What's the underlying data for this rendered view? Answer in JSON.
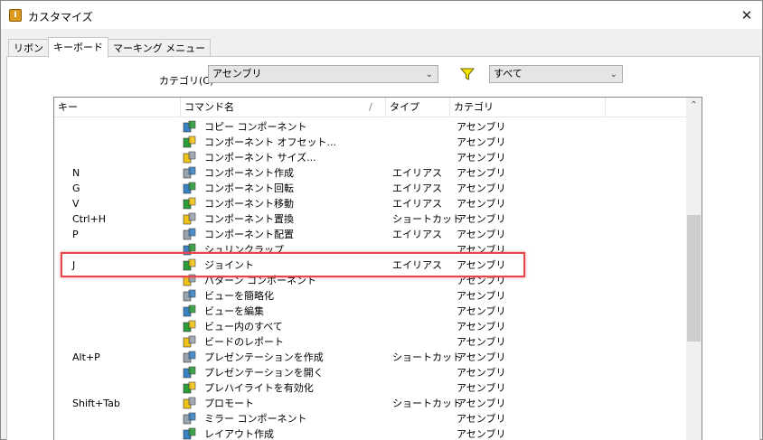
{
  "window": {
    "title": "カスタマイズ",
    "close_label": "✕"
  },
  "tabs": [
    {
      "label": "リボン",
      "active": false
    },
    {
      "label": "キーボード",
      "active": true
    },
    {
      "label": "マーキング メニュー",
      "active": false
    }
  ],
  "filter": {
    "category_label": "カテゴリ(C)",
    "category_value": "アセンブリ",
    "scope_value": "すべて"
  },
  "table": {
    "columns": {
      "key": "キー",
      "command": "コマンド名",
      "type": "タイプ",
      "category": "カテゴリ"
    },
    "rows": [
      {
        "key": "",
        "icon": "copy-component-icon",
        "name": "コピー コンポーネント",
        "type": "",
        "category": "アセンブリ"
      },
      {
        "key": "",
        "icon": "component-offset-icon",
        "name": "コンポーネント オフセット...",
        "type": "",
        "category": "アセンブリ"
      },
      {
        "key": "",
        "icon": "component-size-icon",
        "name": "コンポーネント サイズ...",
        "type": "",
        "category": "アセンブリ"
      },
      {
        "key": "N",
        "icon": "create-component-icon",
        "name": "コンポーネント作成",
        "type": "エイリアス",
        "category": "アセンブリ"
      },
      {
        "key": "G",
        "icon": "rotate-component-icon",
        "name": "コンポーネント回転",
        "type": "エイリアス",
        "category": "アセンブリ"
      },
      {
        "key": "V",
        "icon": "move-component-icon",
        "name": "コンポーネント移動",
        "type": "エイリアス",
        "category": "アセンブリ"
      },
      {
        "key": "Ctrl+H",
        "icon": "replace-component-icon",
        "name": "コンポーネント置換",
        "type": "ショートカット",
        "category": "アセンブリ"
      },
      {
        "key": "P",
        "icon": "place-component-icon",
        "name": "コンポーネント配置",
        "type": "エイリアス",
        "category": "アセンブリ"
      },
      {
        "key": "",
        "icon": "shrinkwrap-icon",
        "name": "シュリンクラップ",
        "type": "",
        "category": "アセンブリ"
      },
      {
        "key": "J",
        "icon": "joint-icon",
        "name": "ジョイント",
        "type": "エイリアス",
        "category": "アセンブリ"
      },
      {
        "key": "",
        "icon": "pattern-component-icon",
        "name": "パターン コンポーネント",
        "type": "",
        "category": "アセンブリ"
      },
      {
        "key": "",
        "icon": "simplify-view-icon",
        "name": "ビューを簡略化",
        "type": "",
        "category": "アセンブリ"
      },
      {
        "key": "",
        "icon": "edit-view-icon",
        "name": "ビューを編集",
        "type": "",
        "category": "アセンブリ"
      },
      {
        "key": "",
        "icon": "all-in-view-icon",
        "name": "ビュー内のすべて",
        "type": "",
        "category": "アセンブリ"
      },
      {
        "key": "",
        "icon": "bead-report-icon",
        "name": "ビードのレポート",
        "type": "",
        "category": "アセンブリ"
      },
      {
        "key": "Alt+P",
        "icon": "create-presentation-icon",
        "name": "プレゼンテーションを作成",
        "type": "ショートカット",
        "category": "アセンブリ"
      },
      {
        "key": "",
        "icon": "open-presentation-icon",
        "name": "プレゼンテーションを開く",
        "type": "",
        "category": "アセンブリ"
      },
      {
        "key": "",
        "icon": "enable-prehighlight-icon",
        "name": "プレハイライトを有効化",
        "type": "",
        "category": "アセンブリ"
      },
      {
        "key": "Shift+Tab",
        "icon": "promote-icon",
        "name": "プロモート",
        "type": "ショートカット",
        "category": "アセンブリ"
      },
      {
        "key": "",
        "icon": "mirror-component-icon",
        "name": "ミラー コンポーネント",
        "type": "",
        "category": "アセンブリ"
      },
      {
        "key": "",
        "icon": "create-layout-icon",
        "name": "レイアウト作成",
        "type": "",
        "category": "アセンブリ"
      }
    ]
  },
  "highlighted_row_index": 9
}
